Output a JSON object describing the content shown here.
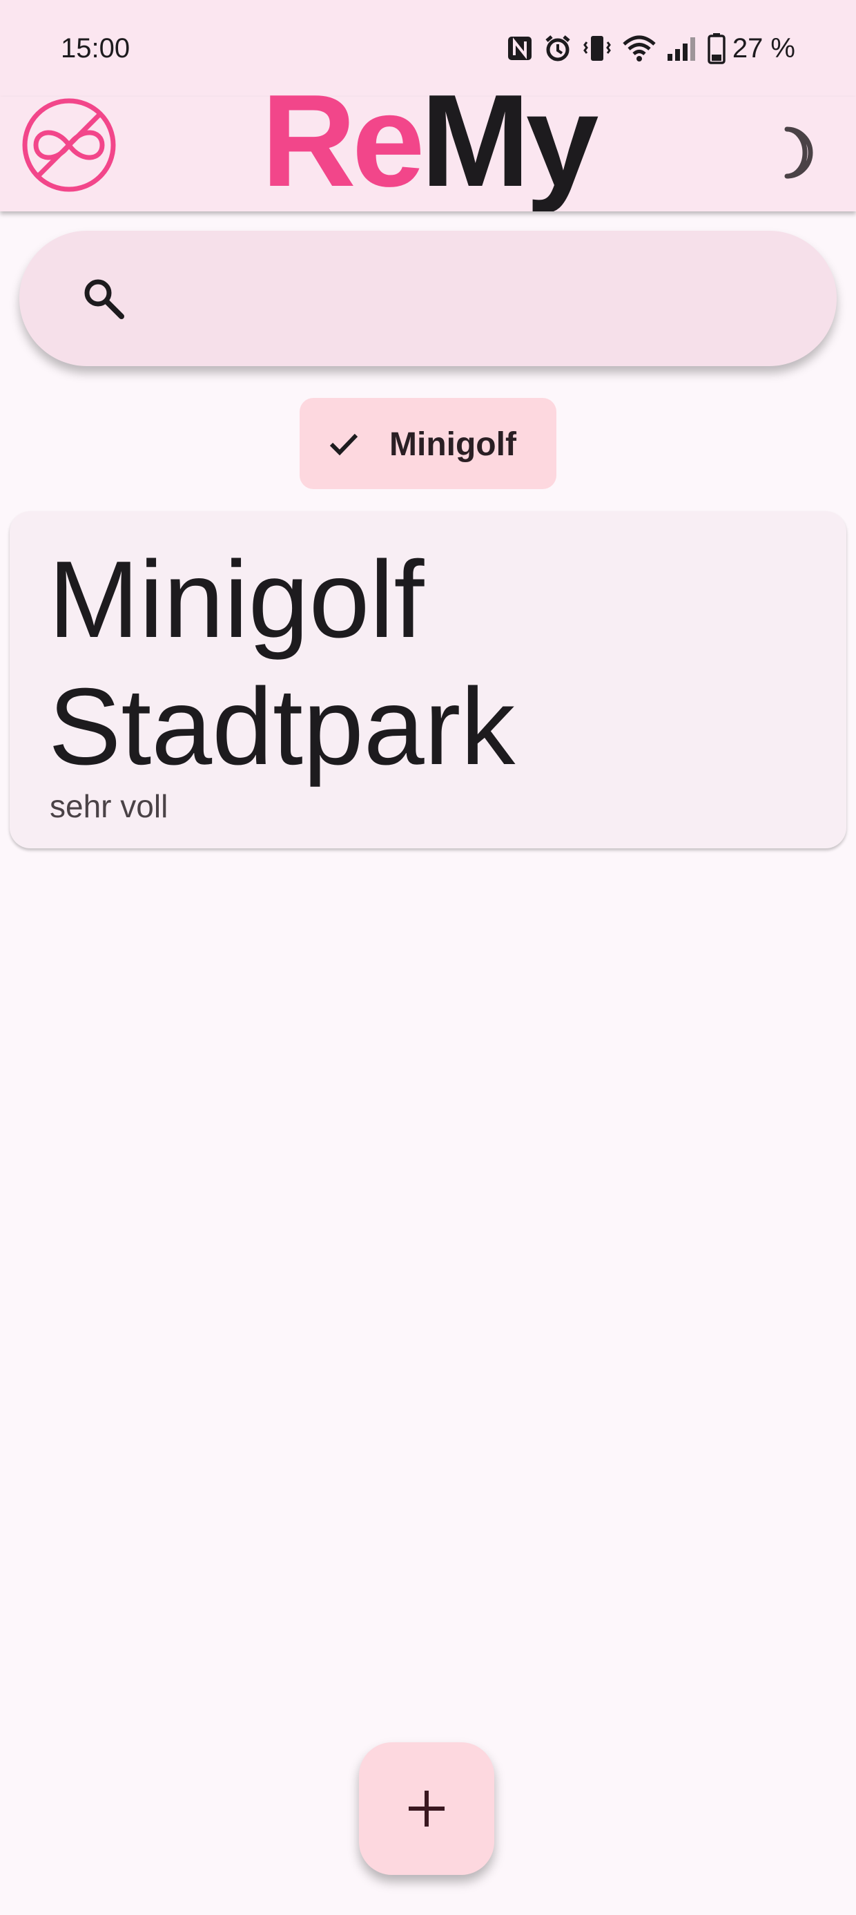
{
  "status_bar": {
    "time": "15:00",
    "battery_percent": "27 %",
    "icons": [
      "nfc-icon",
      "alarm-icon",
      "vibrate-icon",
      "wifi-icon",
      "signal-icon",
      "battery-icon"
    ]
  },
  "app_bar": {
    "title_part1": "Re",
    "title_part2": "My",
    "logo_icon": "infinity-slash-icon",
    "theme_icon": "moon-icon",
    "colors": {
      "accent": "#f2468a",
      "background": "#fbe6f0"
    }
  },
  "search": {
    "placeholder": "",
    "value": "",
    "icon": "search-icon"
  },
  "filters": [
    {
      "label": "Minigolf",
      "selected": true,
      "icon": "check-icon"
    }
  ],
  "cards": [
    {
      "title": "Minigolf Stadtpark",
      "subtitle": "sehr voll"
    }
  ],
  "fab": {
    "icon": "plus-icon"
  }
}
